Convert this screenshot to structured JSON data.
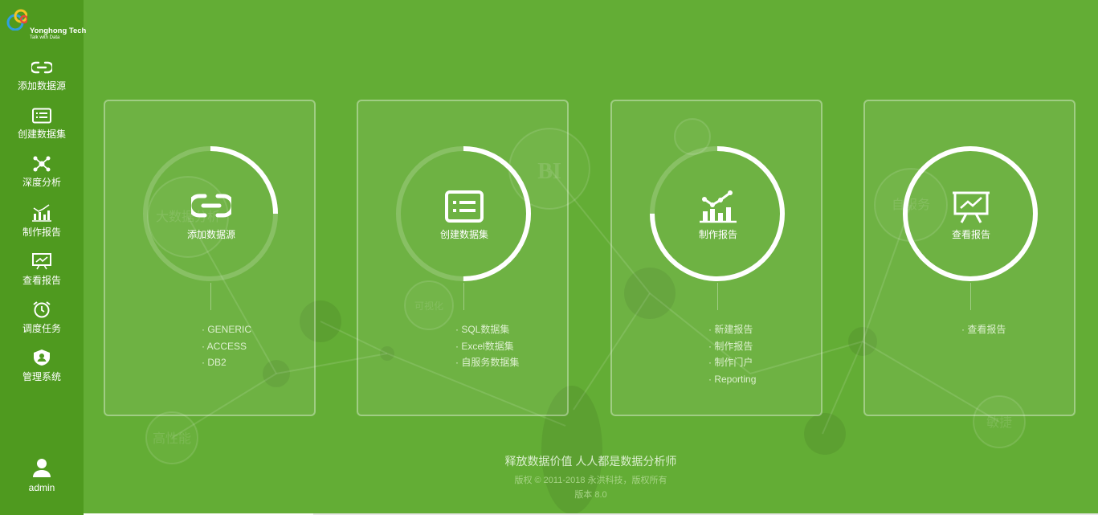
{
  "app": {
    "logo": {
      "name": "Yonghong Tech",
      "tagline": "Talk with Data"
    },
    "sidebar": {
      "items": [
        {
          "label": "添加数据源",
          "icon": "link-icon"
        },
        {
          "label": "创建数据集",
          "icon": "dataset-list-icon"
        },
        {
          "label": "深度分析",
          "icon": "network-nodes-icon"
        },
        {
          "label": "制作报告",
          "icon": "bar-chart-icon"
        },
        {
          "label": "查看报告",
          "icon": "presentation-chart-icon"
        },
        {
          "label": "调度任务",
          "icon": "alarm-clock-icon"
        },
        {
          "label": "管理系统",
          "icon": "shield-user-icon"
        }
      ],
      "user": {
        "label": "admin",
        "icon": "user-icon"
      }
    },
    "cards": [
      {
        "title": "添加数据源",
        "icon": "link-icon",
        "progress": 0.25,
        "links": [
          "· GENERIC",
          "· ACCESS",
          "· DB2"
        ]
      },
      {
        "title": "创建数据集",
        "icon": "dataset-list-icon",
        "progress": 0.5,
        "links": [
          "· SQL数据集",
          "· Excel数据集",
          "· 自服务数据集"
        ]
      },
      {
        "title": "制作报告",
        "icon": "bar-chart-icon",
        "progress": 0.75,
        "links": [
          "· 新建报告",
          "· 制作报告",
          "· 制作门户",
          "· Reporting"
        ]
      },
      {
        "title": "查看报告",
        "icon": "presentation-chart-icon",
        "progress": 1.0,
        "links": [
          "· 查看报告"
        ]
      }
    ],
    "background_labels": [
      "大数据分析",
      "BI",
      "可视化",
      "自服务",
      "高性能",
      "敏捷"
    ],
    "footer": {
      "slogan": "释放数据价值 人人都是数据分析师",
      "copyright": "版权 © 2011-2018 永洪科技，版权所有",
      "version": "版本 8.0"
    },
    "colors": {
      "background": "#63ad35",
      "sidebar": "#4f9a1f",
      "accent": "#ffffff"
    }
  }
}
